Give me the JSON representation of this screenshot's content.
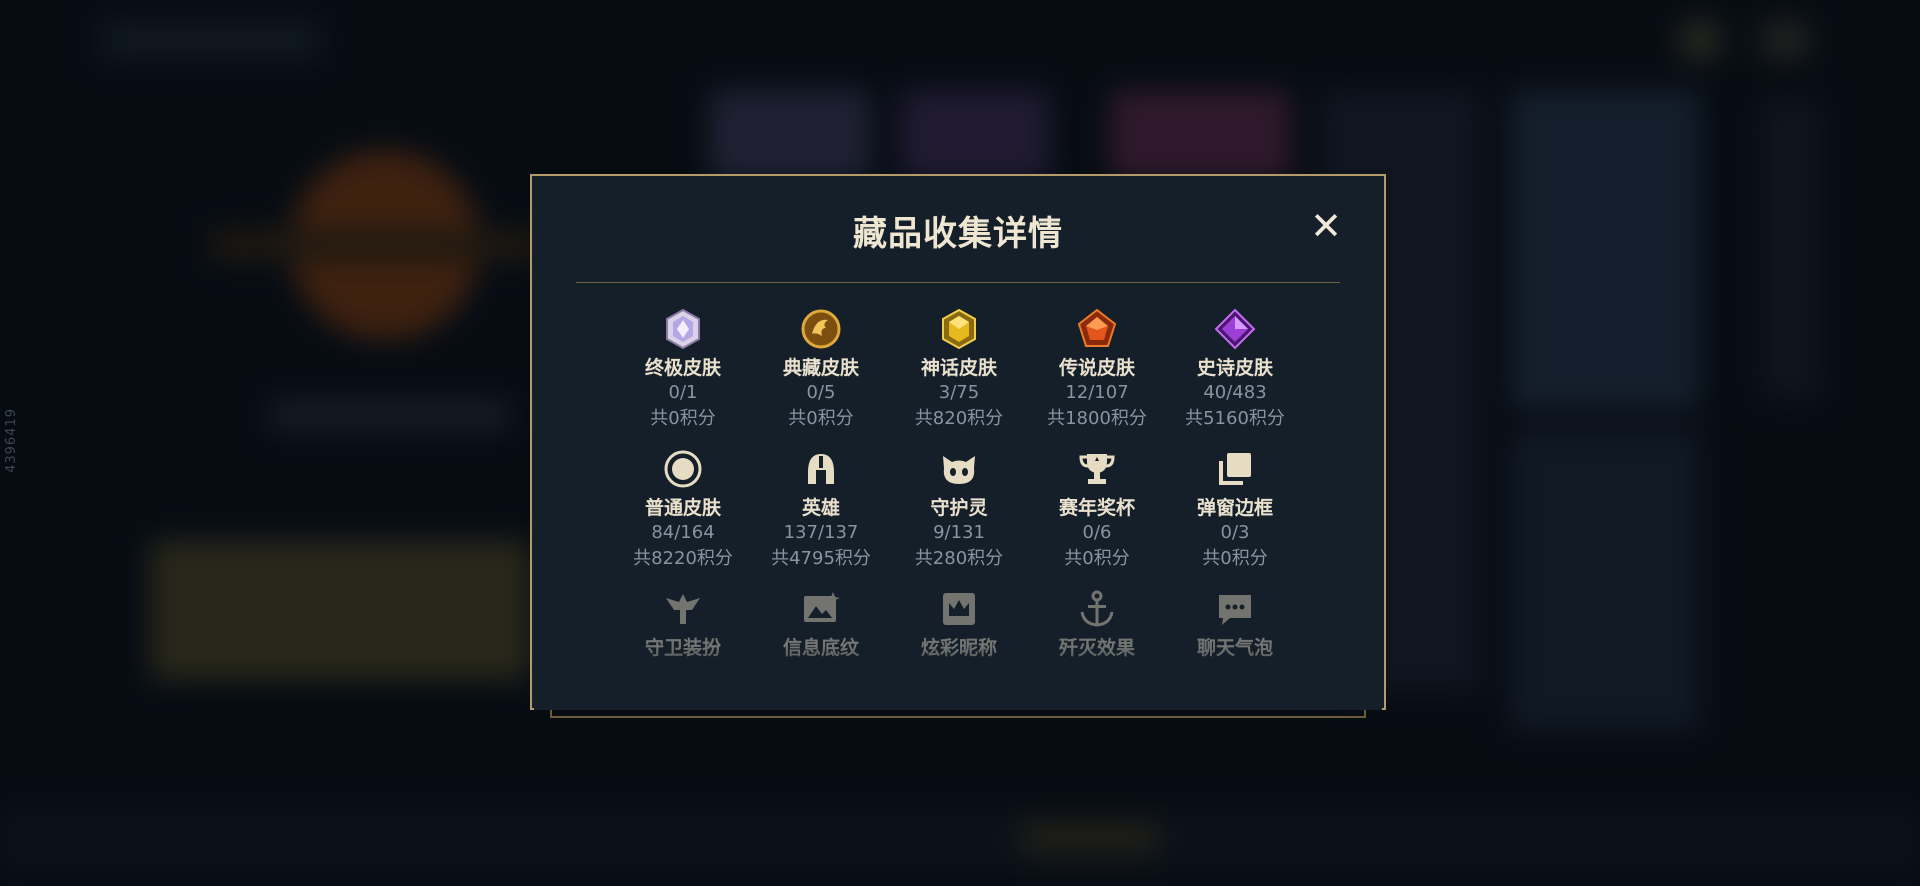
{
  "side_id": "4396419",
  "dialog": {
    "title": "藏品收集详情",
    "close_icon": "close-icon"
  },
  "rows": [
    [
      {
        "icon": "ultimate-gem-icon",
        "label": "终极皮肤",
        "count": "0/1",
        "points": "共0积分"
      },
      {
        "icon": "dragon-emblem-icon",
        "label": "典藏皮肤",
        "count": "0/5",
        "points": "共0积分"
      },
      {
        "icon": "mythic-gem-icon",
        "label": "神话皮肤",
        "count": "3/75",
        "points": "共820积分"
      },
      {
        "icon": "legendary-gem-icon",
        "label": "传说皮肤",
        "count": "12/107",
        "points": "共1800积分"
      },
      {
        "icon": "epic-gem-icon",
        "label": "史诗皮肤",
        "count": "40/483",
        "points": "共5160积分"
      }
    ],
    [
      {
        "icon": "circle-icon",
        "label": "普通皮肤",
        "count": "84/164",
        "points": "共8220积分"
      },
      {
        "icon": "helmet-icon",
        "label": "英雄",
        "count": "137/137",
        "points": "共4795积分"
      },
      {
        "icon": "companion-icon",
        "label": "守护灵",
        "count": "9/131",
        "points": "共280积分"
      },
      {
        "icon": "trophy-icon",
        "label": "赛年奖杯",
        "count": "0/6",
        "points": "共0积分"
      },
      {
        "icon": "frame-stack-icon",
        "label": "弹窗边框",
        "count": "0/3",
        "points": "共0积分"
      }
    ],
    [
      {
        "icon": "guardian-icon",
        "label": "守卫装扮"
      },
      {
        "icon": "banner-image-icon",
        "label": "信息底纹"
      },
      {
        "icon": "crown-card-icon",
        "label": "炫彩昵称"
      },
      {
        "icon": "anchor-icon",
        "label": "歼灭效果"
      },
      {
        "icon": "chat-bubble-icon",
        "label": "聊天气泡"
      }
    ]
  ],
  "colors": {
    "accent_gold": "#b59b67",
    "panel_bg": "#141f2a",
    "label": "#e9e1cd",
    "muted": "#8a93a0"
  }
}
